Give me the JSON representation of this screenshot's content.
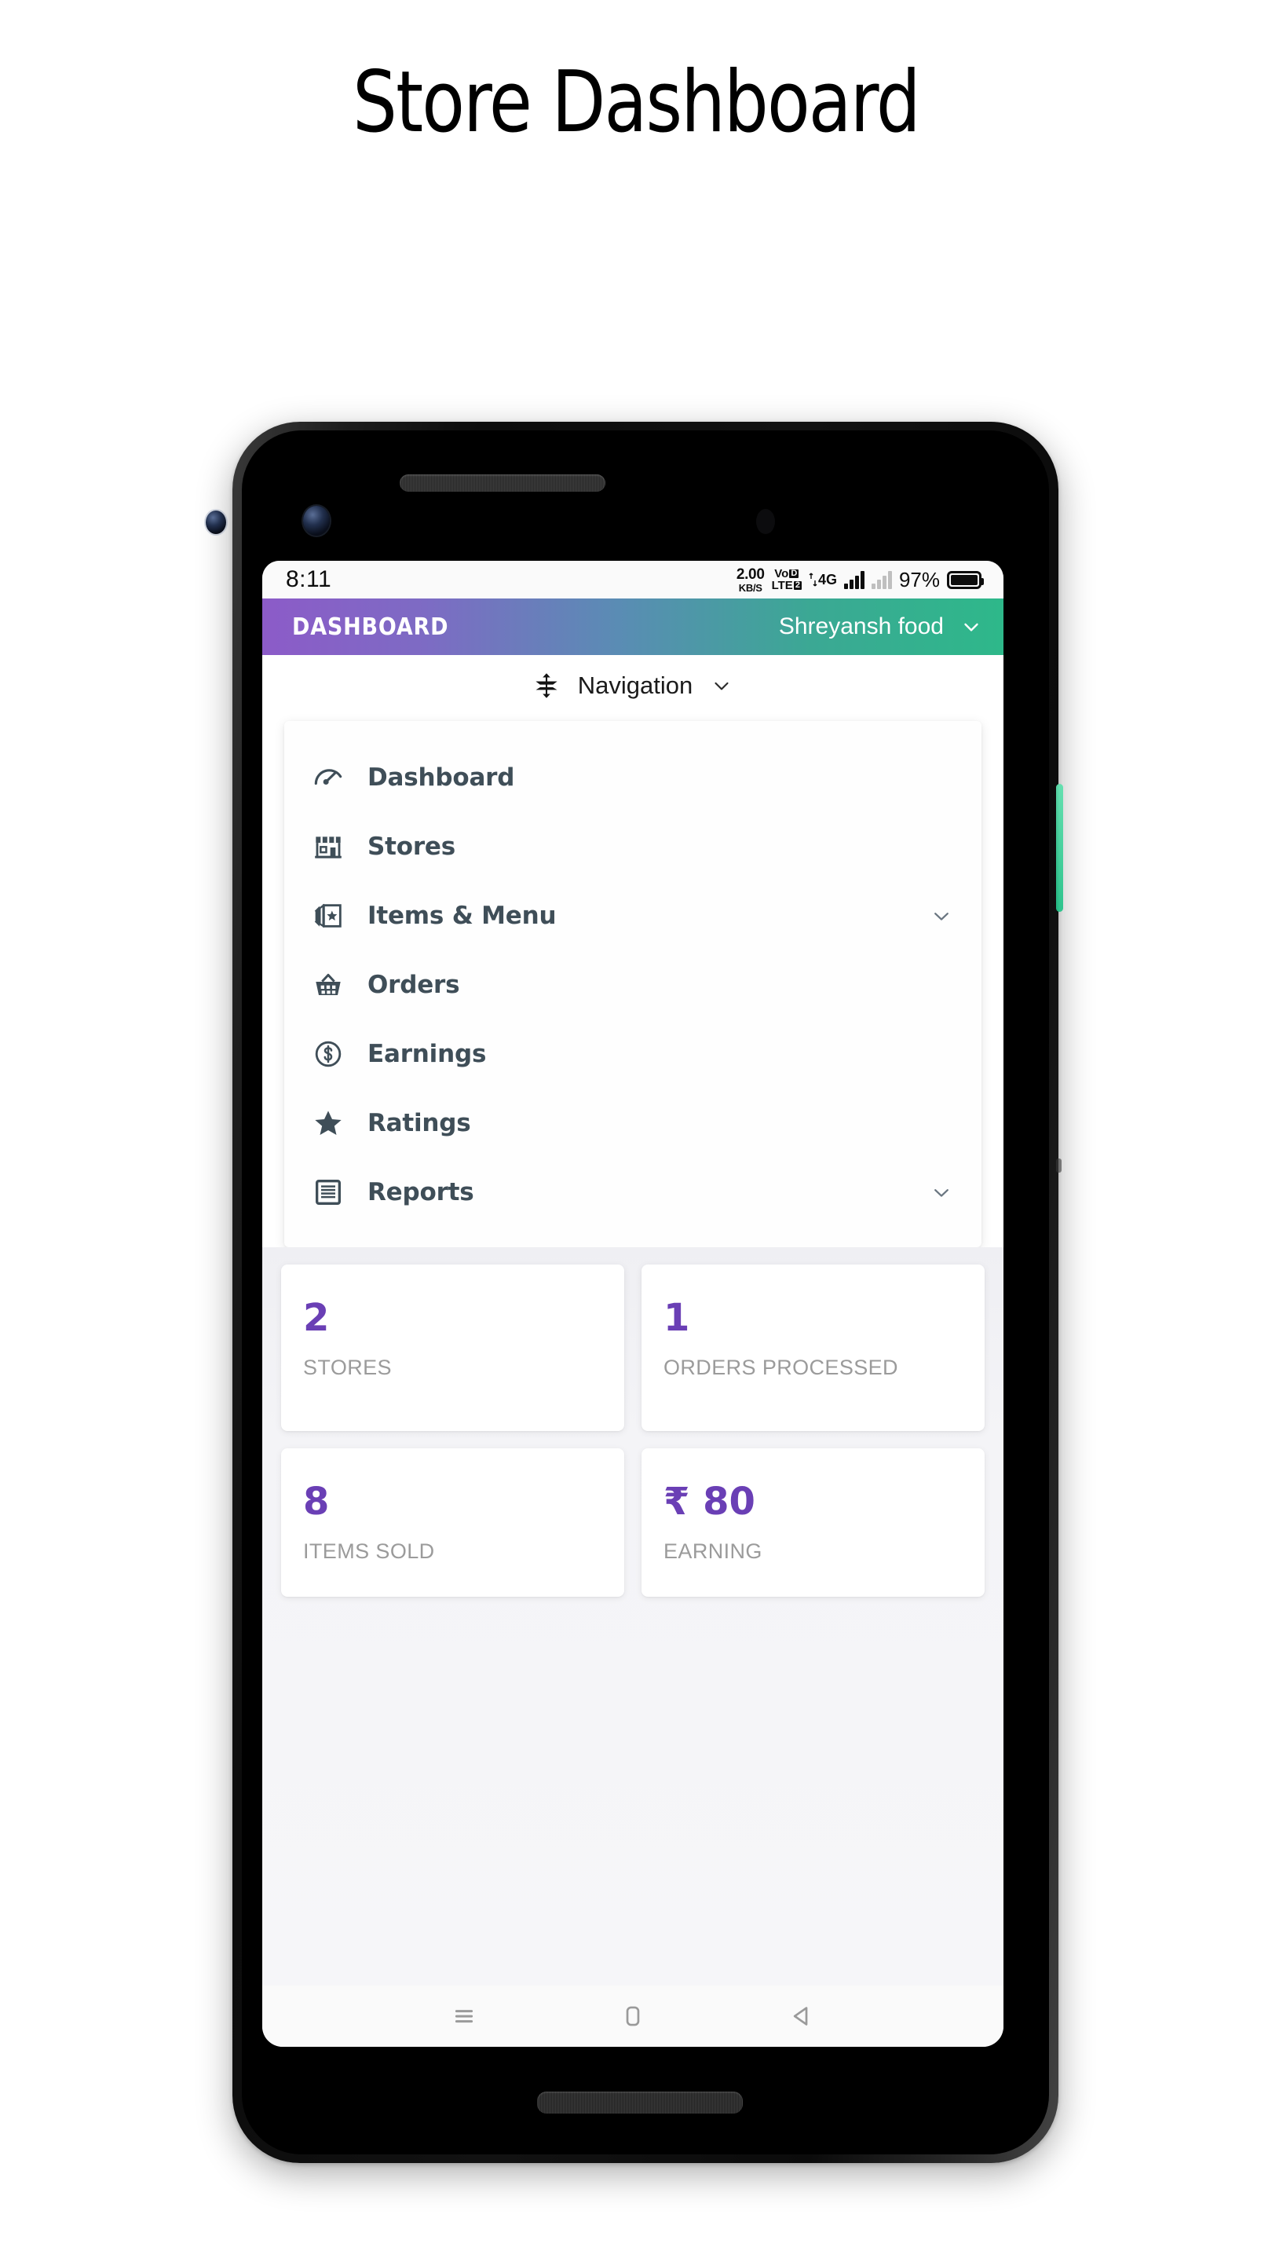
{
  "page": {
    "heading": "Store Dashboard"
  },
  "status_bar": {
    "time": "8:11",
    "net_speed_value": "2.00",
    "net_speed_unit": "KB/S",
    "volte_top": "Vo",
    "volte_top_box": "D",
    "volte_bottom": "LTE",
    "volte_bottom_box": "2",
    "network_type": "4G",
    "battery_percent": "97%"
  },
  "app_bar": {
    "title": "DASHBOARD",
    "store_name": "Shreyansh food",
    "gradient_start": "#8c5bc8",
    "gradient_end": "#2eb88a",
    "dropdown_icon": "chevron-down-icon"
  },
  "nav_toggle": {
    "icon": "expand-collapse-icon",
    "label": "Navigation",
    "chevron": "chevron-down-icon"
  },
  "nav_menu": {
    "items": [
      {
        "label": "Dashboard",
        "icon": "speedometer-icon",
        "expandable": false
      },
      {
        "label": "Stores",
        "icon": "storefront-icon",
        "expandable": false
      },
      {
        "label": "Items & Menu",
        "icon": "cards-star-icon",
        "expandable": true
      },
      {
        "label": "Orders",
        "icon": "basket-icon",
        "expandable": false
      },
      {
        "label": "Earnings",
        "icon": "dollar-circle-icon",
        "expandable": false
      },
      {
        "label": "Ratings",
        "icon": "star-icon",
        "expandable": false
      },
      {
        "label": "Reports",
        "icon": "document-icon",
        "expandable": true
      }
    ]
  },
  "stats": {
    "accent_color": "#6a3fb5",
    "cards": [
      {
        "value": "2",
        "label": "STORES"
      },
      {
        "value": "1",
        "label": "ORDERS PROCESSED"
      },
      {
        "value": "8",
        "label": "ITEMS SOLD"
      },
      {
        "value": "₹ 80",
        "label": "EARNING"
      }
    ]
  },
  "android_nav": {
    "recents": "menu-icon",
    "home": "home-square-icon",
    "back": "back-triangle-icon"
  }
}
